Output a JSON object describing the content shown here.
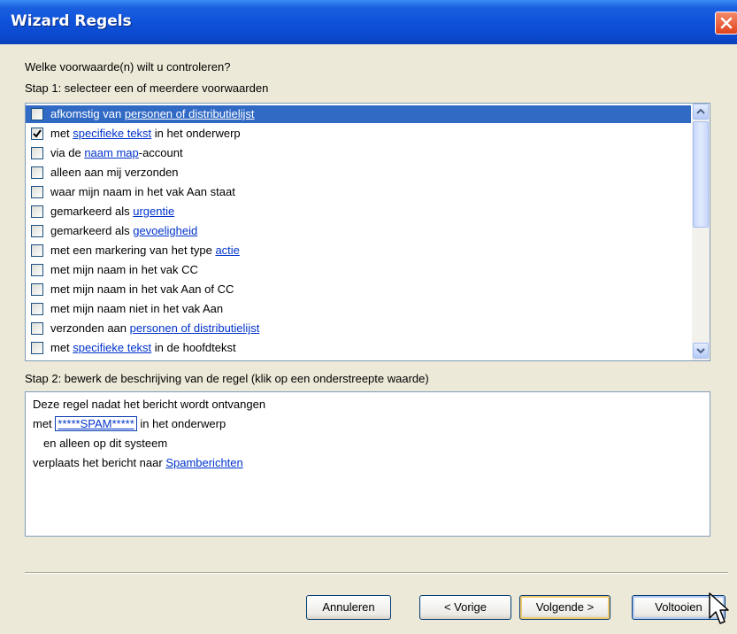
{
  "window": {
    "title": "Wizard Regels"
  },
  "heading": "Welke voorwaarde(n) wilt u controleren?",
  "step1": {
    "label": "Stap 1: selecteer een of meerdere voorwaarden"
  },
  "conditions": [
    {
      "parts": [
        "afkomstig van ",
        "personen of distributielijst",
        ""
      ],
      "checked": false,
      "selected": true
    },
    {
      "parts": [
        "met ",
        "specifieke tekst",
        " in het onderwerp"
      ],
      "checked": true,
      "selected": false
    },
    {
      "parts": [
        "via de ",
        "naam map",
        "-account"
      ],
      "checked": false,
      "selected": false
    },
    {
      "parts": [
        "alleen aan mij verzonden",
        "",
        ""
      ],
      "checked": false,
      "selected": false
    },
    {
      "parts": [
        "waar mijn naam in het vak Aan staat",
        "",
        ""
      ],
      "checked": false,
      "selected": false
    },
    {
      "parts": [
        "gemarkeerd als ",
        "urgentie",
        ""
      ],
      "checked": false,
      "selected": false
    },
    {
      "parts": [
        "gemarkeerd als ",
        "gevoeligheid",
        ""
      ],
      "checked": false,
      "selected": false
    },
    {
      "parts": [
        "met een markering van het type ",
        "actie",
        ""
      ],
      "checked": false,
      "selected": false
    },
    {
      "parts": [
        "met mijn naam in het vak CC",
        "",
        ""
      ],
      "checked": false,
      "selected": false
    },
    {
      "parts": [
        "met mijn naam in het vak Aan of CC",
        "",
        ""
      ],
      "checked": false,
      "selected": false
    },
    {
      "parts": [
        "met mijn naam niet in het vak Aan",
        "",
        ""
      ],
      "checked": false,
      "selected": false
    },
    {
      "parts": [
        "verzonden aan ",
        "personen of distributielijst",
        ""
      ],
      "checked": false,
      "selected": false
    },
    {
      "parts": [
        "met ",
        "specifieke tekst",
        " in de hoofdtekst"
      ],
      "checked": false,
      "selected": false
    }
  ],
  "step2": {
    "label": "Stap 2: bewerk de beschrijving van de regel (klik op een onderstreepte waarde)"
  },
  "description": {
    "line1": "Deze regel nadat het bericht wordt ontvangen",
    "line2_pre": "met ",
    "line2_value": "*****SPAM*****",
    "line2_post": " in het onderwerp",
    "line3": "en alleen op dit systeem",
    "line4_pre": "verplaats het bericht naar ",
    "line4_link": "Spamberichten"
  },
  "buttons": {
    "cancel": "Annuleren",
    "back": "< Vorige",
    "next": "Volgende >",
    "finish": "Voltooien"
  },
  "colors": {
    "titlebar": "#0F52DA",
    "selection": "#316AC5",
    "link": "#0033CC"
  }
}
